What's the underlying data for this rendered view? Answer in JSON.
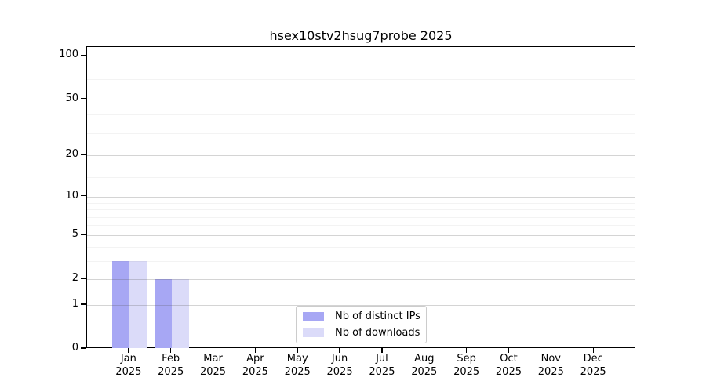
{
  "title": "hsex10stv2hsug7probe 2025",
  "chart_data": {
    "type": "bar",
    "title": "hsex10stv2hsug7probe 2025",
    "scale": "log1p",
    "categories": [
      "Jan",
      "Feb",
      "Mar",
      "Apr",
      "May",
      "Jun",
      "Jul",
      "Aug",
      "Sep",
      "Oct",
      "Nov",
      "Dec"
    ],
    "year_label": "2025",
    "series": [
      {
        "name": "Nb of distinct IPs",
        "color": "#a7a7f4",
        "values": [
          3,
          2,
          0,
          0,
          0,
          0,
          0,
          0,
          0,
          0,
          0,
          0
        ]
      },
      {
        "name": "Nb of downloads",
        "color": "#dbdbf9",
        "values": [
          3,
          2,
          0,
          0,
          0,
          0,
          0,
          0,
          0,
          0,
          0,
          0
        ]
      }
    ],
    "y_ticks": [
      0,
      1,
      2,
      5,
      10,
      20,
      50,
      100
    ],
    "y_minor_ticks": [
      3,
      4,
      6,
      7,
      8,
      9,
      14,
      29,
      39,
      59,
      69,
      79,
      89
    ],
    "ylim": [
      0,
      114
    ],
    "grid": true,
    "legend_position": "bottom-center"
  },
  "colors": {
    "background": "#ffffff",
    "axis": "#000000",
    "major_grid": "#d4d4d4",
    "minor_grid": "#efefef",
    "legend_border": "#cccccc"
  }
}
